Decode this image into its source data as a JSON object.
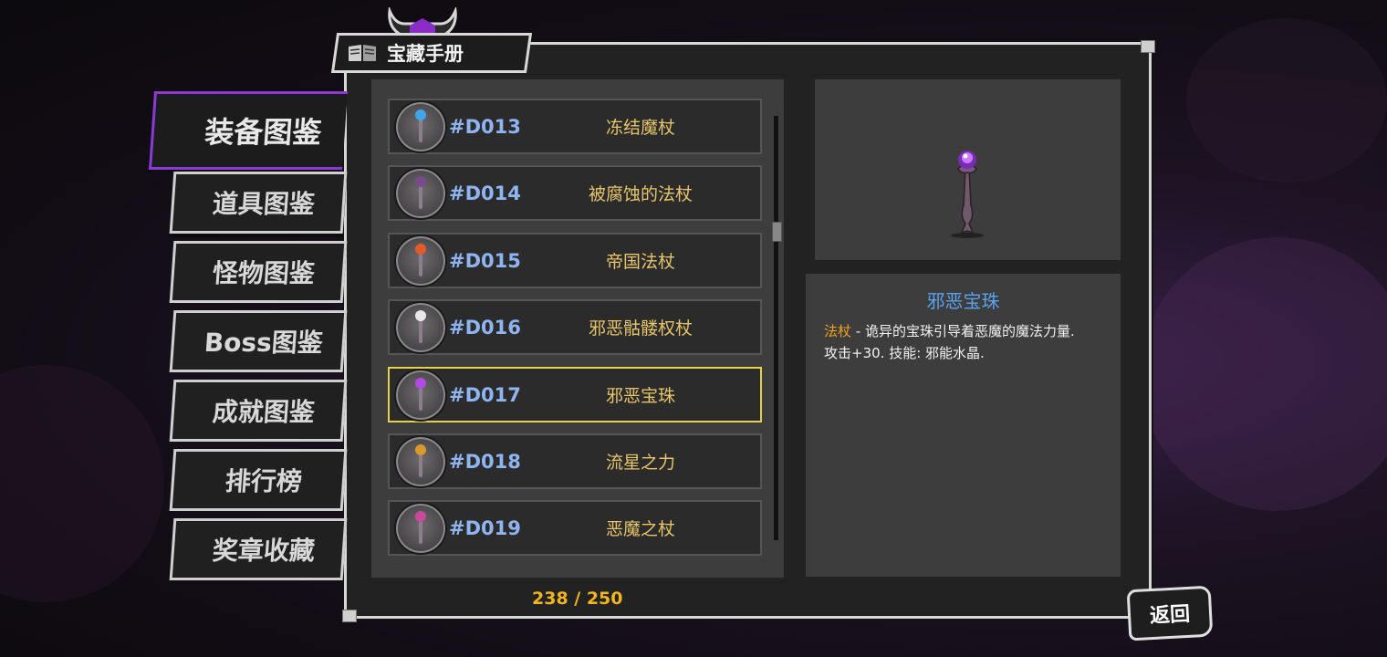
{
  "title": "宝藏手册",
  "tabs": [
    {
      "label": "装备图鉴",
      "active": true
    },
    {
      "label": "道具图鉴",
      "active": false
    },
    {
      "label": "怪物图鉴",
      "active": false
    },
    {
      "label": "Boss图鉴",
      "active": false
    },
    {
      "label": "成就图鉴",
      "active": false
    },
    {
      "label": "排行榜",
      "active": false
    },
    {
      "label": "奖章收藏",
      "active": false
    }
  ],
  "items": [
    {
      "code": "#D013",
      "name": "冻结魔杖",
      "gem_color": "#3fa6e8",
      "selected": false
    },
    {
      "code": "#D014",
      "name": "被腐蚀的法杖",
      "gem_color": "#7a4b8c",
      "selected": false
    },
    {
      "code": "#D015",
      "name": "帝国法杖",
      "gem_color": "#e35b2c",
      "selected": false
    },
    {
      "code": "#D016",
      "name": "邪恶骷髅权杖",
      "gem_color": "#e8e8e8",
      "selected": false
    },
    {
      "code": "#D017",
      "name": "邪恶宝珠",
      "gem_color": "#b04ae0",
      "selected": true
    },
    {
      "code": "#D018",
      "name": "流星之力",
      "gem_color": "#d99a2a",
      "selected": false
    },
    {
      "code": "#D019",
      "name": "恶魔之杖",
      "gem_color": "#c84a9a",
      "selected": false
    }
  ],
  "counter": "238 / 250",
  "detail": {
    "name": "邪恶宝珠",
    "type": "法杖",
    "desc_line1": " - 诡异的宝珠引导着恶魔的魔法力量.",
    "desc_line2": "攻击+30. 技能: 邪能水晶."
  },
  "back_label": "返回"
}
